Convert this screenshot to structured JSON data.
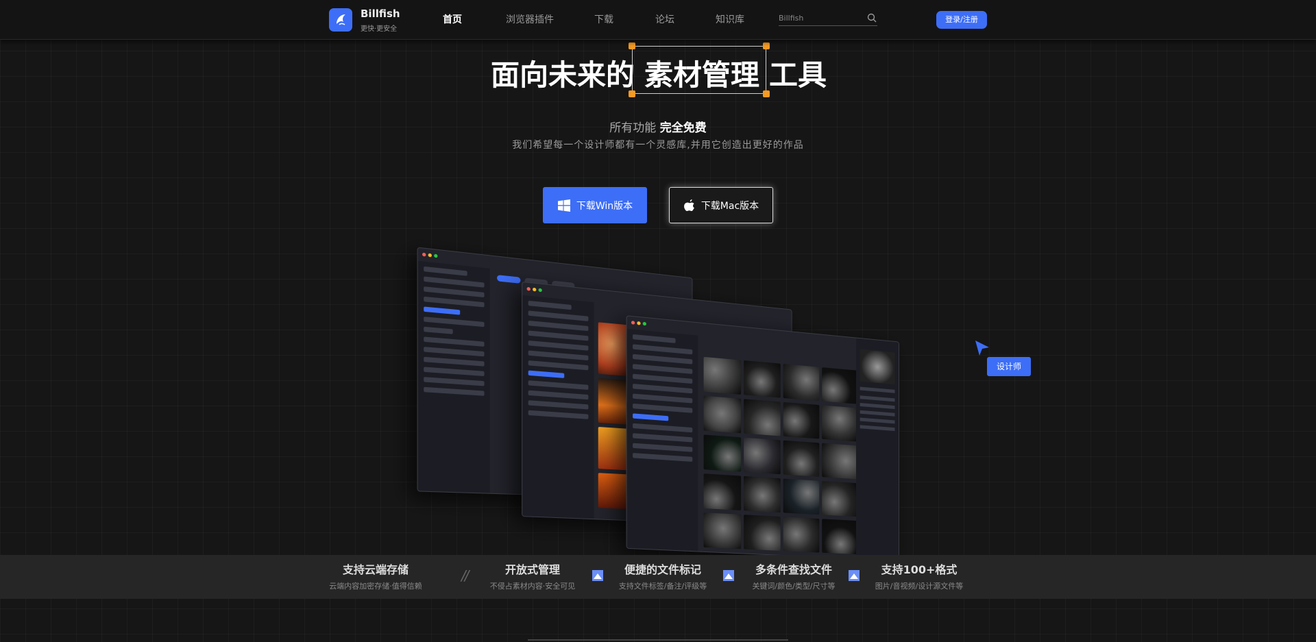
{
  "header": {
    "brand": "Billfish",
    "slogan": "更快·更安全",
    "nav": [
      {
        "label": "首页",
        "active": true
      },
      {
        "label": "浏览器插件",
        "active": false
      },
      {
        "label": "下载",
        "active": false
      },
      {
        "label": "论坛",
        "active": false
      },
      {
        "label": "知识库",
        "active": false
      }
    ],
    "search_placeholder": "Billfish",
    "login_label": "登录/注册"
  },
  "hero": {
    "title_prefix": "面向未来的",
    "title_highlight": "素材管理",
    "title_suffix": "工具",
    "subhead_normal": "所有功能",
    "subhead_strong": "完全免费",
    "description": "我们希望每一个设计师都有一个灵感库,并用它创造出更好的作品",
    "win_button": "下载Win版本",
    "mac_button": "下载Mac版本"
  },
  "illustration": {
    "cursor_tag": "设计师"
  },
  "features": [
    {
      "title": "支持云端存储",
      "subtitle": "云端内容加密存储·值得信赖"
    },
    {
      "title": "开放式管理",
      "subtitle": "不侵占素材内容·安全可见"
    },
    {
      "title": "便捷的文件标记",
      "subtitle": "支持文件标签/备注/评级等"
    },
    {
      "title": "多条件查找文件",
      "subtitle": "关键词/颜色/类型/尺寸等"
    },
    {
      "title": "支持100+格式",
      "subtitle": "图片/音视频/设计源文件等"
    }
  ],
  "colors": {
    "accent": "#3d6ef7",
    "handle": "#f59a23",
    "background": "#161616"
  },
  "icons": [
    "billfish-logo-icon",
    "search-icon",
    "windows-icon",
    "apple-icon",
    "cursor-arrow-icon",
    "feature-divider-icon"
  ]
}
